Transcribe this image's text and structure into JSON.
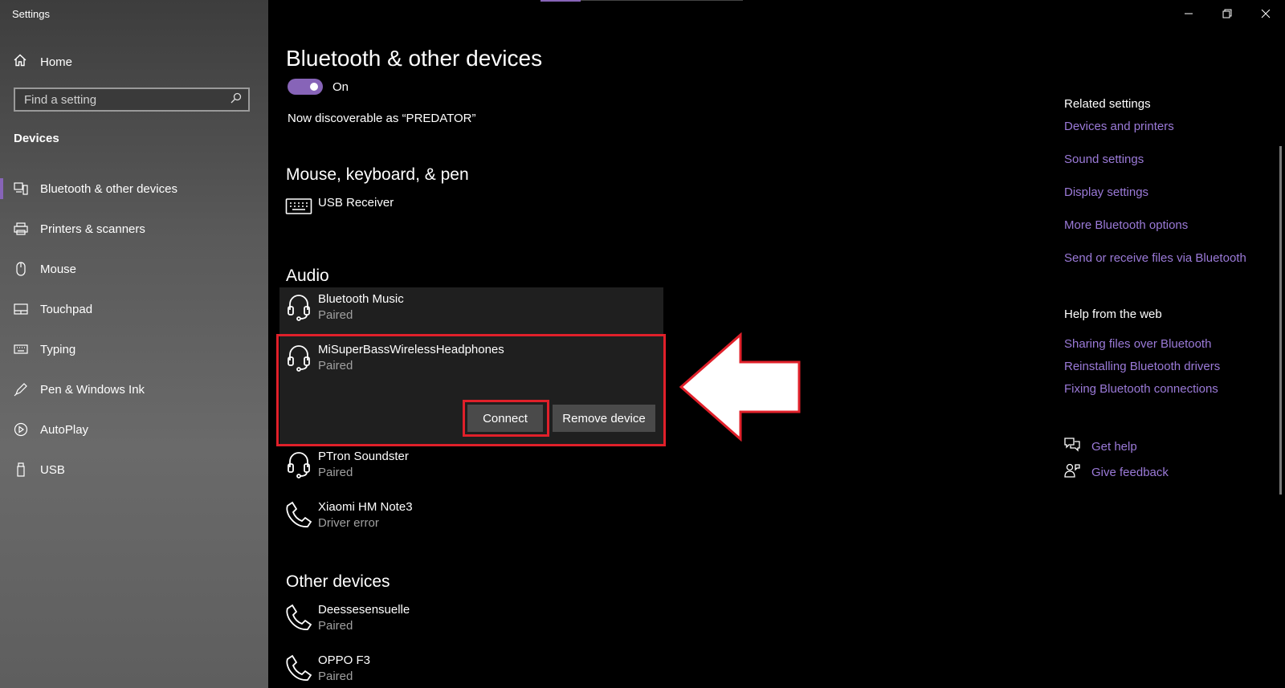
{
  "window": {
    "title": "Settings"
  },
  "sidebar": {
    "home_label": "Home",
    "search_placeholder": "Find a setting",
    "section_label": "Devices",
    "items": [
      {
        "label": "Bluetooth & other devices",
        "icon": "bluetooth-devices-icon",
        "active": true
      },
      {
        "label": "Printers & scanners",
        "icon": "printer-icon"
      },
      {
        "label": "Mouse",
        "icon": "mouse-icon"
      },
      {
        "label": "Touchpad",
        "icon": "touchpad-icon"
      },
      {
        "label": "Typing",
        "icon": "keyboard-icon"
      },
      {
        "label": "Pen & Windows Ink",
        "icon": "pen-icon"
      },
      {
        "label": "AutoPlay",
        "icon": "autoplay-icon"
      },
      {
        "label": "USB",
        "icon": "usb-icon"
      }
    ]
  },
  "main": {
    "title": "Bluetooth & other devices",
    "bluetooth_toggle": {
      "state_label": "On",
      "on": true
    },
    "discoverable_text": "Now discoverable as “PREDATOR”",
    "groups": {
      "mouse_keyboard_pen": {
        "title": "Mouse, keyboard, & pen",
        "devices": [
          {
            "name": "USB Receiver",
            "status": "",
            "icon": "keyboard-icon"
          }
        ]
      },
      "audio": {
        "title": "Audio",
        "devices": [
          {
            "name": "Bluetooth Music",
            "status": "Paired",
            "icon": "headset-icon"
          },
          {
            "name": "MiSuperBassWirelessHeadphones",
            "status": "Paired",
            "icon": "headset-icon"
          },
          {
            "name": "PTron Soundster",
            "status": "Paired",
            "icon": "headset-icon"
          },
          {
            "name": "Xiaomi HM Note3",
            "status": "Driver error",
            "icon": "phone-icon"
          }
        ]
      },
      "other": {
        "title": "Other devices",
        "devices": [
          {
            "name": "Deessesensuelle",
            "status": "Paired",
            "icon": "phone-icon"
          },
          {
            "name": "OPPO F3",
            "status": "Paired",
            "icon": "phone-icon"
          }
        ]
      }
    },
    "actions": {
      "connect_label": "Connect",
      "remove_label": "Remove device"
    }
  },
  "related": {
    "heading": "Related settings",
    "links": [
      "Devices and printers",
      "Sound settings",
      "Display settings",
      "More Bluetooth options",
      "Send or receive files via Bluetooth"
    ]
  },
  "help": {
    "heading": "Help from the web",
    "links": [
      "Sharing files over Bluetooth",
      "Reinstalling Bluetooth drivers",
      "Fixing Bluetooth connections"
    ],
    "get_help_label": "Get help",
    "feedback_label": "Give feedback"
  },
  "colors": {
    "accent": "#8764b8",
    "link": "#9b7ad8",
    "highlight": "#e0202a"
  }
}
